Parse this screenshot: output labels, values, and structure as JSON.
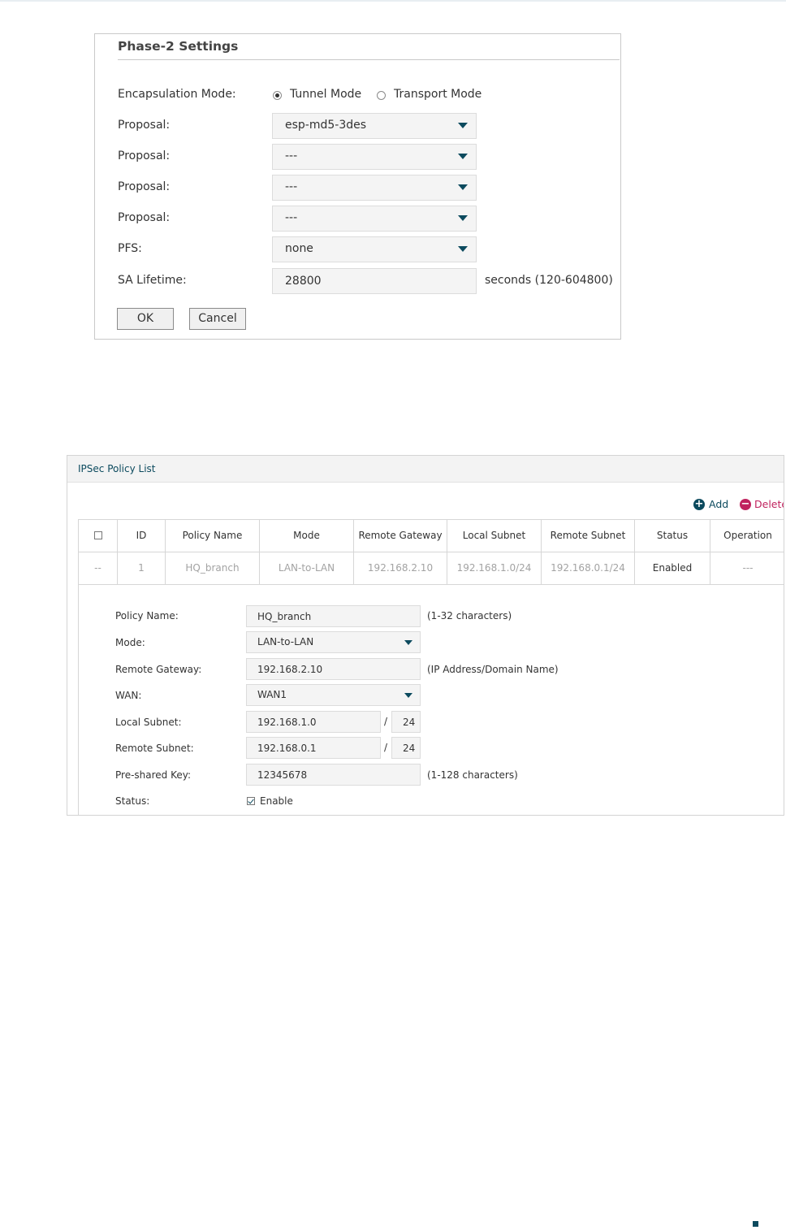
{
  "phase2": {
    "title": "Phase-2 Settings",
    "encapsulation": {
      "label": "Encapsulation Mode:",
      "options": [
        "Tunnel Mode",
        "Transport Mode"
      ],
      "selected": "Tunnel Mode"
    },
    "proposals": [
      {
        "label": "Proposal:",
        "value": "esp-md5-3des"
      },
      {
        "label": "Proposal:",
        "value": "---"
      },
      {
        "label": "Proposal:",
        "value": "---"
      },
      {
        "label": "Proposal:",
        "value": "---"
      }
    ],
    "pfs": {
      "label": "PFS:",
      "value": "none"
    },
    "sa_lifetime": {
      "label": "SA Lifetime:",
      "value": "28800",
      "hint": "seconds (120-604800)"
    },
    "ok_label": "OK",
    "cancel_label": "Cancel"
  },
  "ipsec": {
    "title": "IPSec Policy List",
    "add_label": "Add",
    "delete_label": "Delete",
    "columns": [
      "ID",
      "Policy Name",
      "Mode",
      "Remote Gateway",
      "Local Subnet",
      "Remote Subnet",
      "Status",
      "Operation"
    ],
    "row": {
      "select": "--",
      "id": "1",
      "policy_name": "HQ_branch",
      "mode": "LAN-to-LAN",
      "remote_gateway": "192.168.2.10",
      "local_subnet": "192.168.1.0/24",
      "remote_subnet": "192.168.0.1/24",
      "status": "Enabled",
      "operation": "---"
    },
    "form": {
      "policy_name": {
        "label": "Policy Name:",
        "value": "HQ_branch",
        "hint": "(1-32 characters)"
      },
      "mode": {
        "label": "Mode:",
        "value": "LAN-to-LAN"
      },
      "remote_gateway": {
        "label": "Remote Gateway:",
        "value": "192.168.2.10",
        "hint": "(IP Address/Domain Name)"
      },
      "wan": {
        "label": "WAN:",
        "value": "WAN1"
      },
      "local_subnet": {
        "label": "Local Subnet:",
        "ip": "192.168.1.0",
        "mask": "24"
      },
      "remote_subnet": {
        "label": "Remote Subnet:",
        "ip": "192.168.0.1",
        "mask": "24"
      },
      "preshared_key": {
        "label": "Pre-shared Key:",
        "value": "12345678",
        "hint": "(1-128 characters)"
      },
      "status": {
        "label": "Status:",
        "checkbox_label": "Enable",
        "checked": true
      },
      "slash": "/"
    }
  },
  "colors": {
    "accent": "#0c4a5e",
    "add_icon": "#0c4a5e",
    "delete_icon": "#c0225e"
  }
}
